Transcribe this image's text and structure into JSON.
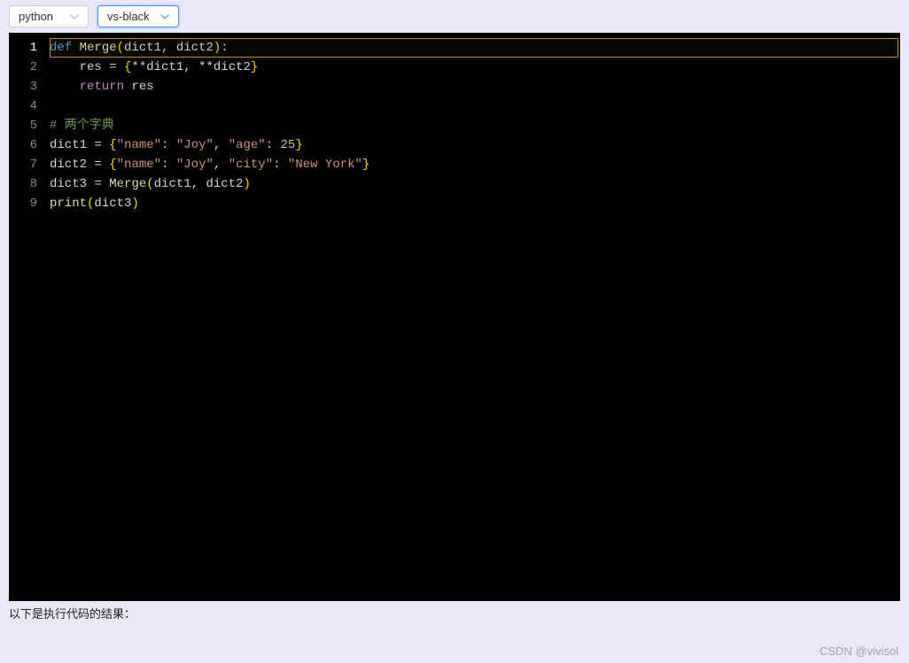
{
  "controls": {
    "language_select": "python",
    "theme_select": "vs-black"
  },
  "code": {
    "active_line": 1,
    "lines": [
      {
        "n": 1,
        "tokens": [
          {
            "t": "def ",
            "c": "tok-kw"
          },
          {
            "t": "Merge",
            "c": "tok-fn"
          },
          {
            "t": "(",
            "c": "tok-punc"
          },
          {
            "t": "dict1",
            "c": "tok-var"
          },
          {
            "t": ", ",
            "c": "tok-op"
          },
          {
            "t": "dict2",
            "c": "tok-var"
          },
          {
            "t": ")",
            "c": "tok-punc"
          },
          {
            "t": ":",
            "c": "tok-op"
          }
        ]
      },
      {
        "n": 2,
        "tokens": [
          {
            "t": "    ",
            "c": "tok-op"
          },
          {
            "t": "res ",
            "c": "tok-var"
          },
          {
            "t": "= ",
            "c": "tok-op"
          },
          {
            "t": "{",
            "c": "tok-punc"
          },
          {
            "t": "**",
            "c": "tok-op"
          },
          {
            "t": "dict1",
            "c": "tok-var"
          },
          {
            "t": ", ",
            "c": "tok-op"
          },
          {
            "t": "**",
            "c": "tok-op"
          },
          {
            "t": "dict2",
            "c": "tok-var"
          },
          {
            "t": "}",
            "c": "tok-punc"
          }
        ]
      },
      {
        "n": 3,
        "tokens": [
          {
            "t": "    ",
            "c": "tok-op"
          },
          {
            "t": "return ",
            "c": "tok-ret"
          },
          {
            "t": "res",
            "c": "tok-var"
          }
        ]
      },
      {
        "n": 4,
        "tokens": []
      },
      {
        "n": 5,
        "tokens": [
          {
            "t": "# 两个字典",
            "c": "tok-cmt"
          }
        ]
      },
      {
        "n": 6,
        "tokens": [
          {
            "t": "dict1 ",
            "c": "tok-var"
          },
          {
            "t": "= ",
            "c": "tok-op"
          },
          {
            "t": "{",
            "c": "tok-punc"
          },
          {
            "t": "\"name\"",
            "c": "tok-str"
          },
          {
            "t": ": ",
            "c": "tok-op"
          },
          {
            "t": "\"Joy\"",
            "c": "tok-str"
          },
          {
            "t": ", ",
            "c": "tok-op"
          },
          {
            "t": "\"age\"",
            "c": "tok-str"
          },
          {
            "t": ": ",
            "c": "tok-op"
          },
          {
            "t": "25",
            "c": "tok-num"
          },
          {
            "t": "}",
            "c": "tok-punc"
          }
        ]
      },
      {
        "n": 7,
        "tokens": [
          {
            "t": "dict2 ",
            "c": "tok-var"
          },
          {
            "t": "= ",
            "c": "tok-op"
          },
          {
            "t": "{",
            "c": "tok-punc"
          },
          {
            "t": "\"name\"",
            "c": "tok-str"
          },
          {
            "t": ": ",
            "c": "tok-op"
          },
          {
            "t": "\"Joy\"",
            "c": "tok-str"
          },
          {
            "t": ", ",
            "c": "tok-op"
          },
          {
            "t": "\"city\"",
            "c": "tok-str"
          },
          {
            "t": ": ",
            "c": "tok-op"
          },
          {
            "t": "\"New York\"",
            "c": "tok-str"
          },
          {
            "t": "}",
            "c": "tok-punc"
          }
        ]
      },
      {
        "n": 8,
        "tokens": [
          {
            "t": "dict3 ",
            "c": "tok-var"
          },
          {
            "t": "= ",
            "c": "tok-op"
          },
          {
            "t": "Merge",
            "c": "tok-fn"
          },
          {
            "t": "(",
            "c": "tok-punc"
          },
          {
            "t": "dict1",
            "c": "tok-var"
          },
          {
            "t": ", ",
            "c": "tok-op"
          },
          {
            "t": "dict2",
            "c": "tok-var"
          },
          {
            "t": ")",
            "c": "tok-punc"
          }
        ]
      },
      {
        "n": 9,
        "tokens": [
          {
            "t": "print",
            "c": "tok-print"
          },
          {
            "t": "(",
            "c": "tok-punc"
          },
          {
            "t": "dict3",
            "c": "tok-var"
          },
          {
            "t": ")",
            "c": "tok-punc"
          }
        ]
      }
    ]
  },
  "result_label": "以下是执行代码的结果：",
  "watermark": "CSDN @vivisol"
}
